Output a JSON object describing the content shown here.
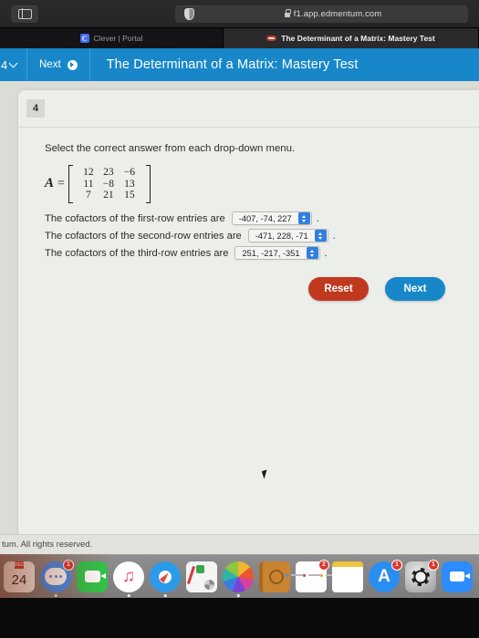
{
  "browser": {
    "sidebar_icon": "sidebar-toggle-icon",
    "privacy_icon": "privacy-shield-icon",
    "url": "f1.app.edmentum.com",
    "lock_icon": "lock-icon",
    "tabs": [
      {
        "title": "Clever | Portal",
        "favicon": "clever-favicon",
        "active": false
      },
      {
        "title": "The Determinant of a Matrix: Mastery Test",
        "favicon": "edmentum-favicon",
        "active": true
      }
    ]
  },
  "app_header": {
    "question_selector": "4",
    "chevron_icon": "chevron-down-icon",
    "next_label": "Next",
    "next_icon": "next-arrow-circle-icon",
    "title": "The Determinant of a Matrix: Mastery Test",
    "bg_color": "#1787c9"
  },
  "question": {
    "number": "4",
    "instruction": "Select the correct answer from each drop-down menu.",
    "matrix": {
      "name": "A",
      "equals": "=",
      "rows": [
        [
          "12",
          "23",
          "−6"
        ],
        [
          "11",
          "−8",
          "13"
        ],
        [
          "7",
          "21",
          "15"
        ]
      ]
    },
    "cofactor_lines": [
      {
        "label": "The cofactors of the first-row entries are",
        "selected": "-407, -74, 227",
        "punctuation": "."
      },
      {
        "label": "The cofactors of the second-row entries are",
        "selected": "-471, 228, -71",
        "punctuation": "."
      },
      {
        "label": "The cofactors of the third-row entries are",
        "selected": "251, -217, -351",
        "punctuation": "."
      }
    ]
  },
  "actions": {
    "reset_label": "Reset",
    "reset_color": "#c0391f",
    "next_label": "Next",
    "next_color": "#1787c9"
  },
  "footer": {
    "text": "tum. All rights reserved."
  },
  "dock": {
    "items": [
      {
        "name": "calendar",
        "month": "DEC",
        "day": "24",
        "badge": ""
      },
      {
        "name": "messages",
        "badge": "1"
      },
      {
        "name": "facetime",
        "badge": ""
      },
      {
        "name": "music",
        "glyph": "♫",
        "badge": ""
      },
      {
        "name": "safari",
        "badge": ""
      },
      {
        "name": "utility-app",
        "badge": ""
      },
      {
        "name": "photos",
        "badge": ""
      },
      {
        "name": "contacts",
        "badge": ""
      },
      {
        "name": "reminders",
        "badge": "2"
      },
      {
        "name": "notes",
        "badge": ""
      },
      {
        "name": "app-store",
        "glyph": "A",
        "badge": "1"
      },
      {
        "name": "system-preferences",
        "badge": "1"
      },
      {
        "name": "zoom",
        "badge": ""
      }
    ]
  }
}
